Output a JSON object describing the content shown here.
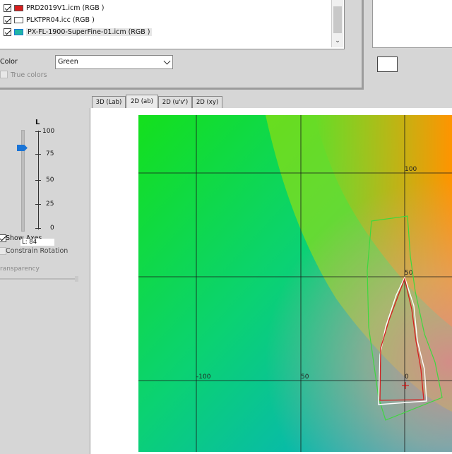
{
  "profiles": {
    "items": [
      {
        "label": "PRD2019V1.icm (RGB )",
        "swatch": "#d81e1e",
        "checked": true
      },
      {
        "label": "PLKTPR04.icc (RGB )",
        "swatch": "#ffffff",
        "checked": true
      },
      {
        "label": "PX-FL-1900-SuperFine-01.icm (RGB )",
        "swatch": "#1fb5a5",
        "checked": true
      }
    ]
  },
  "color": {
    "label": "Color",
    "value": "Green"
  },
  "true_colors": {
    "label": "True colors"
  },
  "tabs": [
    "3D (Lab)",
    "2D (ab)",
    "2D (u'v')",
    "2D (xy)"
  ],
  "active_tab": 1,
  "lightness": {
    "label": "L",
    "ticks": [
      "100",
      "75",
      "50",
      "25",
      "0"
    ],
    "value": 84,
    "readout": "L: 84"
  },
  "show_axes": {
    "label": "Show Axes",
    "checked": true
  },
  "constrain_rotation": {
    "label": "Constrain Rotation",
    "checked": false
  },
  "transparency": {
    "label": "ransparency"
  },
  "plot": {
    "x_labels": [
      "-100",
      "50",
      "0"
    ],
    "y_labels": [
      "100",
      "50"
    ]
  },
  "colors": {
    "gamut_red": "#d42020",
    "gamut_white": "#ffffff",
    "gamut_green": "#3ed83e",
    "accent": "#1a74d6"
  }
}
